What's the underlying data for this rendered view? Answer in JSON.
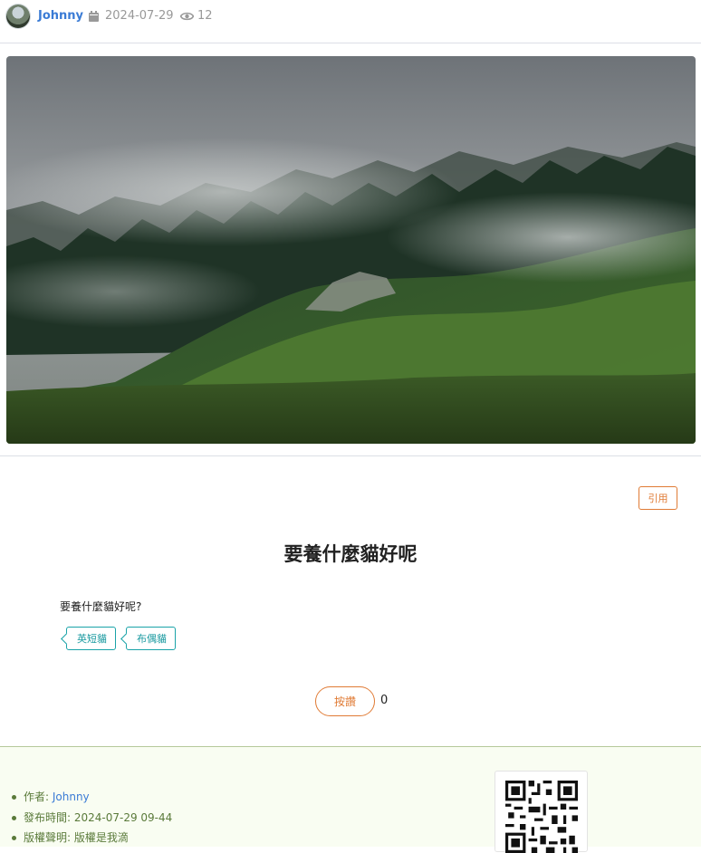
{
  "meta": {
    "author": "Johnny",
    "date": "2024-07-29",
    "views": "12",
    "icons": [
      "avatar",
      "calendar-icon",
      "eye-icon"
    ]
  },
  "hero": {
    "icon": "landscape-photo"
  },
  "actions": {
    "quote_label": "引用"
  },
  "post": {
    "title": "要養什麼貓好呢",
    "body": "要養什麼貓好呢?",
    "tags": [
      "英短貓",
      "布偶貓"
    ]
  },
  "like": {
    "label": "按讚",
    "count": "0"
  },
  "info": {
    "author_label": "作者: ",
    "author_value": "Johnny",
    "published_label": "發布時間: ",
    "published_value": "2024-07-29 09-44",
    "copyright_label": "版權聲明: ",
    "copyright_value": "版權是我滴"
  },
  "colors": {
    "accent_orange": "#e07b35",
    "tag_teal": "#1aa3a8",
    "link_blue": "#3a7bd5",
    "info_green": "#5a7a3a"
  }
}
